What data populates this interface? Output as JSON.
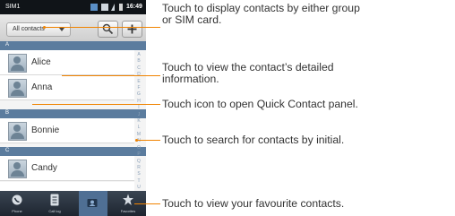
{
  "statusbar": {
    "carrier": "SIM1",
    "time": "16:49"
  },
  "toolbar": {
    "filter_value": "All contacts",
    "search_icon": "search-icon",
    "add_icon": "add-icon"
  },
  "contacts": {
    "sections": [
      "A",
      "B",
      "C"
    ],
    "items": [
      "Alice",
      "Anna",
      "Bonnie",
      "Candy"
    ]
  },
  "index_letters": [
    "A",
    "B",
    "C",
    "D",
    "E",
    "F",
    "G",
    "H",
    "I",
    "J",
    "K",
    "L",
    "M",
    "N",
    "O",
    "P",
    "Q",
    "R",
    "S",
    "T",
    "U",
    "V",
    "W",
    "X",
    "Y",
    "Z"
  ],
  "tabs": [
    {
      "label": "Phone",
      "icon": "phone-icon"
    },
    {
      "label": "Call log",
      "icon": "call-log-icon"
    },
    {
      "label": "Contacts",
      "icon": "contacts-icon"
    },
    {
      "label": "Favorites",
      "icon": "star-icon"
    }
  ],
  "annotations": {
    "group_line1": "Touch to display contacts by either group",
    "group_line2": "or SIM card.",
    "detail_line1": "Touch to view the contact’s detailed",
    "detail_line2": "information.",
    "quick_contact": "Touch icon to open Quick Contact panel.",
    "search_initial": "Touch to search for contacts by initial.",
    "favourites": "Touch to view your favourite contacts."
  },
  "accent_color": "#f08300"
}
